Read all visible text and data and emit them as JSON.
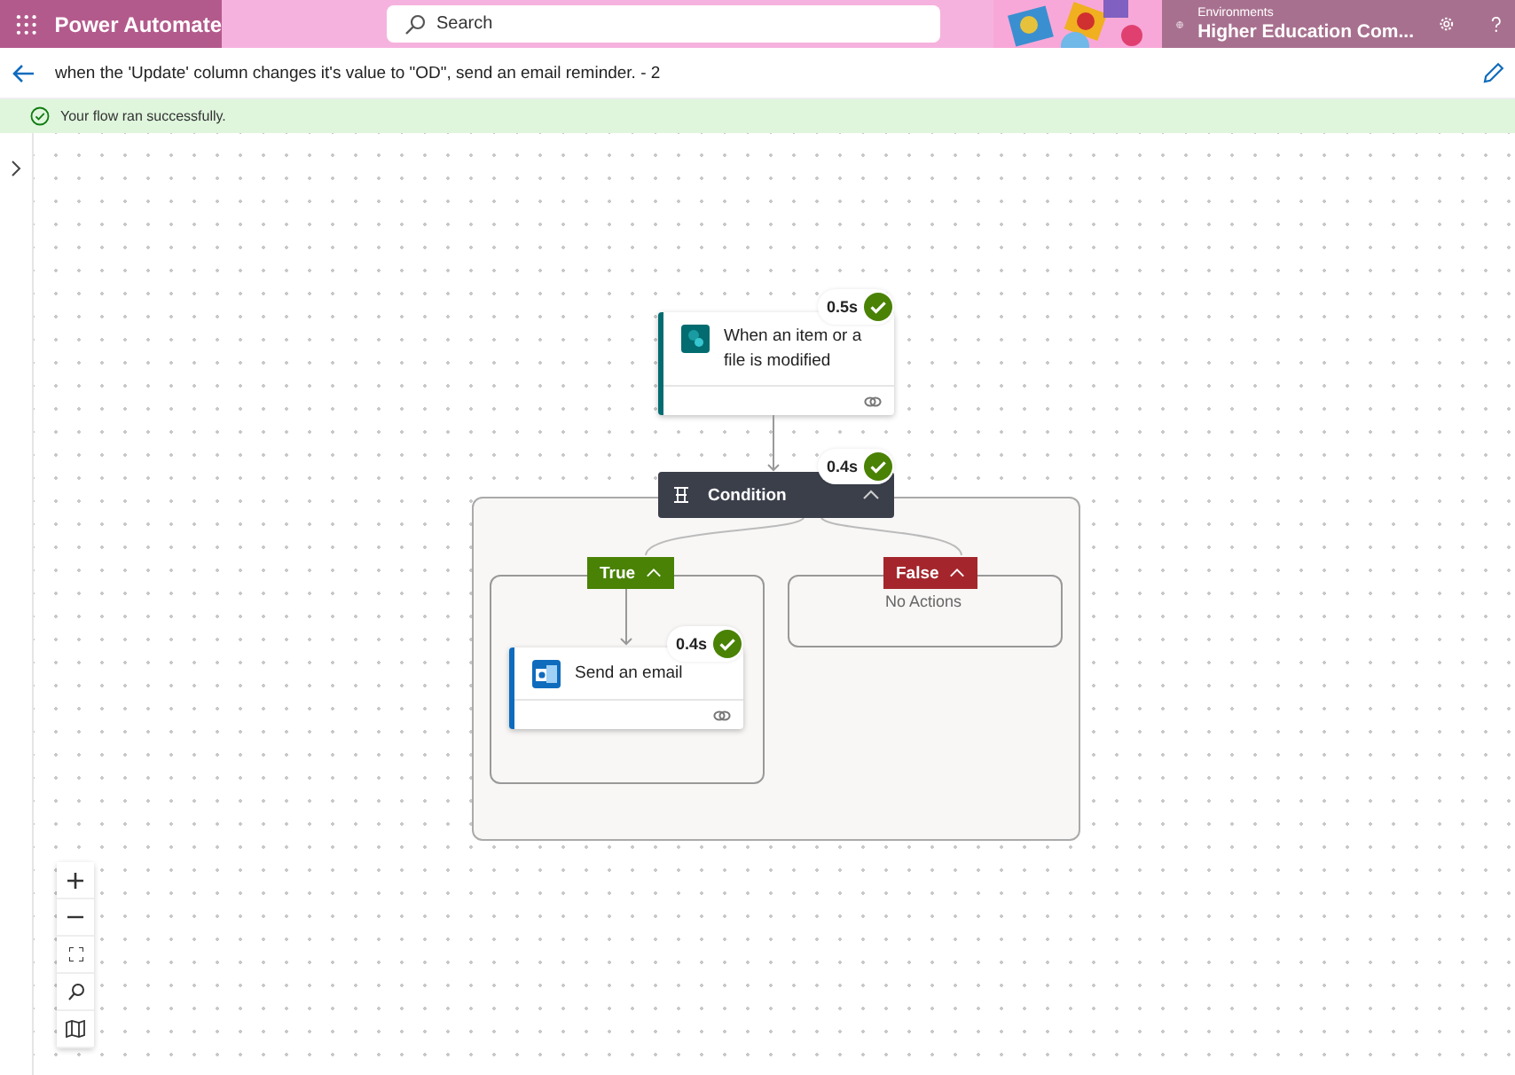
{
  "header": {
    "app_name": "Power Automate",
    "search": {
      "placeholder": "Search"
    },
    "environment_label": "Environments",
    "environment_name": "Higher Education Com..."
  },
  "flow_title": "when the 'Update' column changes it's value to \"OD\", send an email reminder. - 2",
  "status": {
    "message": "Your flow ran successfully.",
    "kind": "success"
  },
  "trigger": {
    "title": "When an item or a file is modified",
    "duration": "0.5s",
    "succeeded": true
  },
  "condition": {
    "title": "Condition",
    "duration": "0.4s",
    "succeeded": true,
    "expanded": true,
    "branches": [
      {
        "label": "True",
        "kind": "true",
        "expanded": true,
        "actions": [
          {
            "title": "Send an email",
            "duration": "0.4s",
            "succeeded": true
          }
        ]
      },
      {
        "label": "False",
        "kind": "false",
        "expanded": true,
        "empty_text": "No Actions"
      }
    ]
  }
}
